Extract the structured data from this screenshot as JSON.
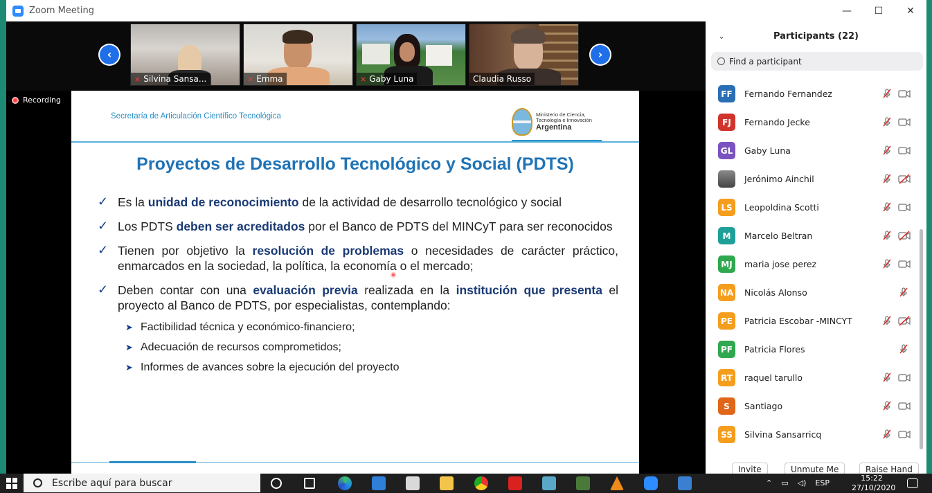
{
  "window": {
    "title": "Zoom Meeting",
    "minimize": "—",
    "maximize": "☐",
    "close": "✕"
  },
  "recording": {
    "label": "Recording"
  },
  "video_thumbs": [
    {
      "name": "Silvina Sansa...",
      "muted": true
    },
    {
      "name": "Emma",
      "muted": true
    },
    {
      "name": "Gaby Luna",
      "muted": true
    },
    {
      "name": "Claudia Russo",
      "muted": false
    }
  ],
  "slide": {
    "header_left": "Secretaría de Articulación Científico Tecnológica",
    "logo_line1": "Ministerio de Ciencia,",
    "logo_line2": "Tecnología e Innovación",
    "logo_country": "Argentina",
    "title": "Proyectos de Desarrollo Tecnológico y Social (PDTS)",
    "bullets": [
      {
        "pre": "Es la ",
        "bold": "unidad de reconocimiento",
        "post": " de la actividad de desarrollo tecnológico y social"
      },
      {
        "pre": "Los PDTS ",
        "bold": "deben ser acreditados",
        "post": " por el Banco de PDTS del MINCyT para ser reconocidos"
      },
      {
        "pre": "Tienen por objetivo la ",
        "bold": "resolución de problemas",
        "post": " o necesidades de carácter práctico, enmarcados en la sociedad, la política, la economía o el mercado;"
      },
      {
        "pre": "Deben contar con una ",
        "bold": "evaluación previa",
        "mid": " realizada en la ",
        "bold2": "institución que presenta",
        "post": " el proyecto al Banco de PDTS, por especialistas, contemplando:"
      }
    ],
    "subbullets": [
      "Factibilidad técnica y económico-financiero;",
      "Adecuación de recursos comprometidos;",
      "Informes de avances sobre la ejecución del proyecto"
    ]
  },
  "participants": {
    "title": "Participants (22)",
    "search_placeholder": "Find a participant",
    "list": [
      {
        "initials": "FF",
        "name": "Fernando Fernandez",
        "color": "#2a6fb5",
        "video_off": false,
        "has_cam": true
      },
      {
        "initials": "FJ",
        "name": "Fernando Jecke",
        "color": "#d0342c",
        "video_off": false,
        "has_cam": true
      },
      {
        "initials": "GL",
        "name": "Gaby Luna",
        "color": "#7b53c1",
        "video_off": false,
        "has_cam": true
      },
      {
        "initials": "",
        "name": "Jerónimo Ainchil",
        "color": "photo",
        "video_off": true,
        "has_cam": true
      },
      {
        "initials": "LS",
        "name": "Leopoldina Scotti",
        "color": "#f59d1d",
        "video_off": false,
        "has_cam": true
      },
      {
        "initials": "M",
        "name": "Marcelo Beltran",
        "color": "#1e9f9a",
        "video_off": true,
        "has_cam": true
      },
      {
        "initials": "MJ",
        "name": "maria jose perez",
        "color": "#2fa84f",
        "video_off": false,
        "has_cam": true
      },
      {
        "initials": "NA",
        "name": "Nicolás Alonso",
        "color": "#f59d1d",
        "video_off": false,
        "has_cam": false
      },
      {
        "initials": "PE",
        "name": "Patricia  Escobar -MINCYT",
        "color": "#f59d1d",
        "video_off": true,
        "has_cam": true
      },
      {
        "initials": "PF",
        "name": "Patricia Flores",
        "color": "#2fa84f",
        "video_off": false,
        "has_cam": false
      },
      {
        "initials": "RT",
        "name": "raquel tarullo",
        "color": "#f59d1d",
        "video_off": false,
        "has_cam": true
      },
      {
        "initials": "S",
        "name": "Santiago",
        "color": "#e0661a",
        "video_off": false,
        "has_cam": true
      },
      {
        "initials": "SS",
        "name": "Silvina Sansarricq",
        "color": "#f59d1d",
        "video_off": false,
        "has_cam": true
      }
    ],
    "buttons": {
      "invite": "Invite",
      "unmute": "Unmute Me",
      "raise_hand": "Raise Hand"
    }
  },
  "taskbar": {
    "search_placeholder": "Escribe aquí para buscar",
    "lang": "ESP",
    "time": "15:22",
    "date": "27/10/2020"
  }
}
